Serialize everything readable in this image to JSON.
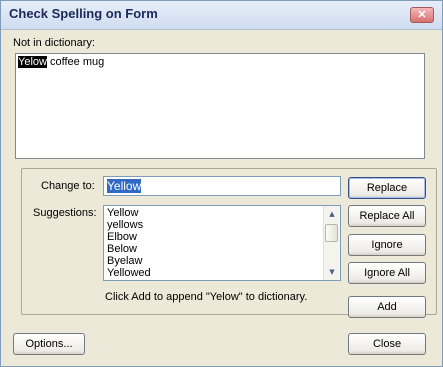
{
  "window": {
    "title": "Check Spelling on Form",
    "close_glyph": "✕"
  },
  "not_in_dictionary": {
    "label": "Not in dictionary:",
    "word": "Yelow",
    "rest": " coffee mug"
  },
  "change_to": {
    "label": "Change to:",
    "value": "Yellow"
  },
  "suggestions": {
    "label": "Suggestions:",
    "items": [
      "Yellow",
      "yellows",
      "Elbow",
      "Below",
      "Byelaw",
      "Yellowed"
    ]
  },
  "buttons": {
    "replace": "Replace",
    "replace_all": "Replace All",
    "ignore": "Ignore",
    "ignore_all": "Ignore All",
    "add": "Add",
    "options": "Options...",
    "close": "Close"
  },
  "hint": "Click Add to append \"Yelow\" to dictionary.",
  "scrollbar": {
    "up_glyph": "▲",
    "down_glyph": "▼"
  }
}
